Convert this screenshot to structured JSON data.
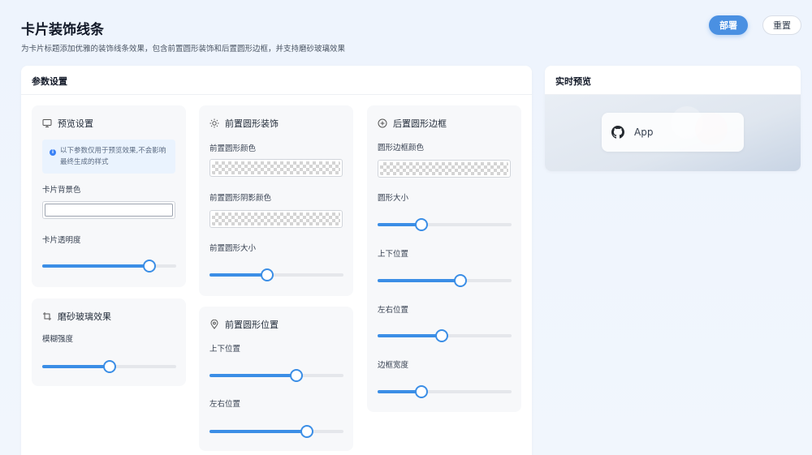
{
  "page": {
    "title": "卡片装饰线条",
    "description": "为卡片标题添加优雅的装饰线条效果，包含前置圆形装饰和后置圆形边框，并支持磨砂玻璃效果",
    "deploy_label": "部署",
    "reset_label": "重置"
  },
  "params_panel": {
    "title": "参数设置",
    "preview_settings": {
      "title": "预览设置",
      "info": "以下参数仅用于预览效果,不会影响最终生成的样式",
      "bg_color_label": "卡片背景色",
      "opacity_label": "卡片透明度",
      "opacity_value": 0.8
    },
    "frosted_glass": {
      "title": "磨砂玻璃效果",
      "blur_label": "模糊强度",
      "blur_value": 0.5
    },
    "front_circle": {
      "title": "前置圆形装饰",
      "color_label": "前置圆形颜色",
      "shadow_color_label": "前置圆形阴影颜色",
      "size_label": "前置圆形大小",
      "size_value": 0.43
    },
    "front_position": {
      "title": "前置圆形位置",
      "vertical_label": "上下位置",
      "vertical_value": 0.65,
      "horizontal_label": "左右位置",
      "horizontal_value": 0.73
    },
    "rear_border": {
      "title": "后置圆形边框",
      "border_color_label": "圆形边框颜色",
      "circle_size_label": "圆形大小",
      "circle_size_value": 0.33,
      "vertical_label": "上下位置",
      "vertical_value": 0.62,
      "horizontal_label": "左右位置",
      "horizontal_value": 0.48,
      "border_width_label": "边框宽度",
      "border_width_value": 0.33
    }
  },
  "preview_panel": {
    "title": "实时预览",
    "app_name": "App"
  },
  "colors": {
    "accent": "#3b8ee6",
    "deploy_button": "#4a90e2"
  }
}
